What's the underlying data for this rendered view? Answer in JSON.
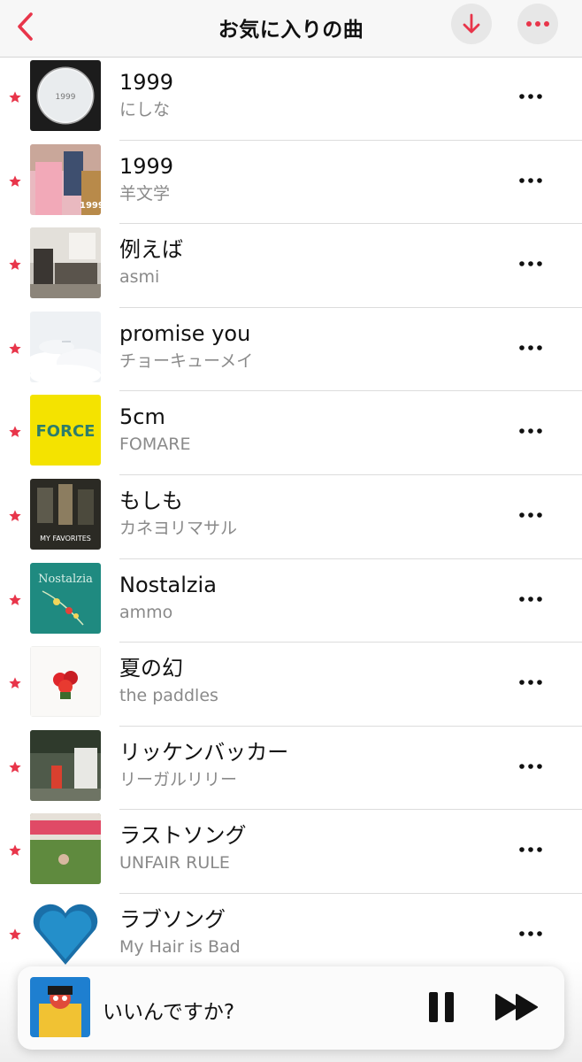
{
  "header": {
    "title": "お気に入りの曲",
    "back_icon": "chevron-left-icon",
    "download_icon": "arrow-down-icon",
    "more_icon": "ellipsis-icon",
    "accent_color": "#e8354a"
  },
  "songs": [
    {
      "title": "1999",
      "artist": "にしな"
    },
    {
      "title": "1999",
      "artist": "羊文学"
    },
    {
      "title": "例えば",
      "artist": "asmi"
    },
    {
      "title": "promise you",
      "artist": "チョーキューメイ"
    },
    {
      "title": "5cm",
      "artist": "FOMARE"
    },
    {
      "title": "もしも",
      "artist": "カネヨリマサル"
    },
    {
      "title": "Nostalzia",
      "artist": "ammo"
    },
    {
      "title": "夏の幻",
      "artist": "the paddles"
    },
    {
      "title": "リッケンバッカー",
      "artist": "リーガルリリー"
    },
    {
      "title": "ラストソング",
      "artist": "UNFAIR RULE"
    },
    {
      "title": "ラブソング",
      "artist": "My Hair is Bad"
    }
  ],
  "album_art_text": {
    "s0": "1999",
    "s1": "1999",
    "s4": "FORCE",
    "s5": "MY FAVORITES",
    "s6": "Nostalzia"
  },
  "now_playing": {
    "title": "いいんですか?",
    "pause_icon": "pause-icon",
    "next_icon": "fast-forward-icon"
  }
}
